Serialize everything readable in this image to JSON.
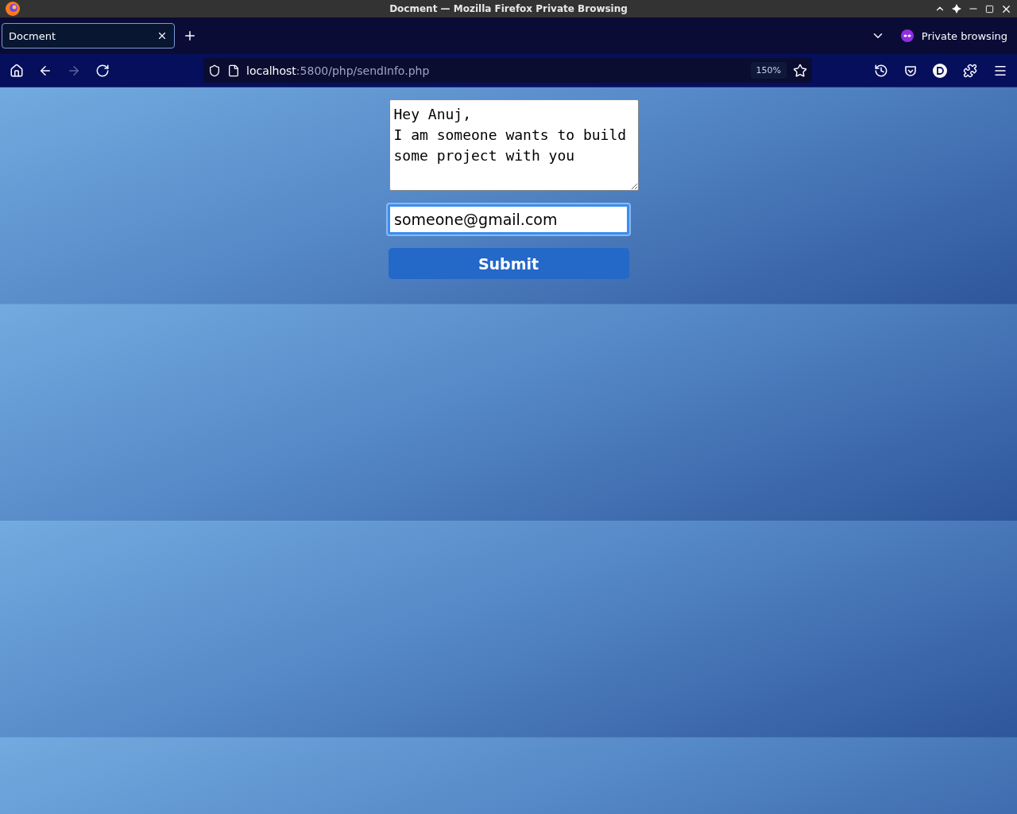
{
  "window": {
    "title": "Docment — Mozilla Firefox Private Browsing"
  },
  "tabs": [
    {
      "label": "Docment",
      "selected": true
    }
  ],
  "private_label": "Private browsing",
  "nav_buttons": [
    {
      "kind": "home",
      "disabled": false
    },
    {
      "kind": "back",
      "disabled": false
    },
    {
      "kind": "forward",
      "disabled": true
    },
    {
      "kind": "reload",
      "disabled": false
    }
  ],
  "address": {
    "host": "localhost",
    "path": ":5800/php/sendInfo.php",
    "zoom": "150%"
  },
  "form": {
    "message": "Hey Anuj,\nI am someone wants to build some project with you",
    "email": "someone@gmail.com",
    "email_focused": true,
    "submit": "Submit"
  }
}
